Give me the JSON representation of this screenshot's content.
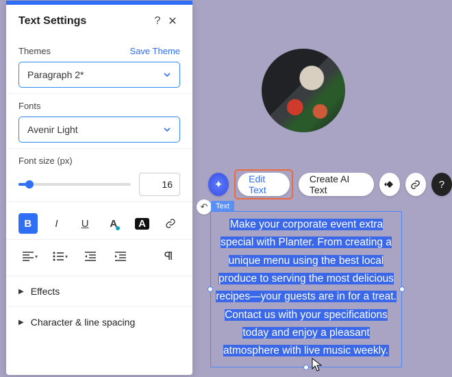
{
  "panel": {
    "title": "Text Settings",
    "help": "?",
    "close": "✕",
    "themes_label": "Themes",
    "save_theme": "Save Theme",
    "themes_value": "Paragraph 2*",
    "fonts_label": "Fonts",
    "fonts_value": "Avenir Light",
    "fontsize_label": "Font size (px)",
    "fontsize_value": "16",
    "format": {
      "bold": "B",
      "italic": "I",
      "underline": "U"
    },
    "effects_label": "Effects",
    "char_spacing_label": "Character & line spacing"
  },
  "toolbar": {
    "edit_text": "Edit Text",
    "create_ai": "Create AI Text"
  },
  "textbox": {
    "tag": "Text",
    "content": "Make your corporate event extra special with Planter. From creating a unique menu using the best local produce to serving the most delicious recipes—your guests are in for a treat. Contact us with your specifications today and enjoy a pleasant atmosphere with live music weekly."
  }
}
